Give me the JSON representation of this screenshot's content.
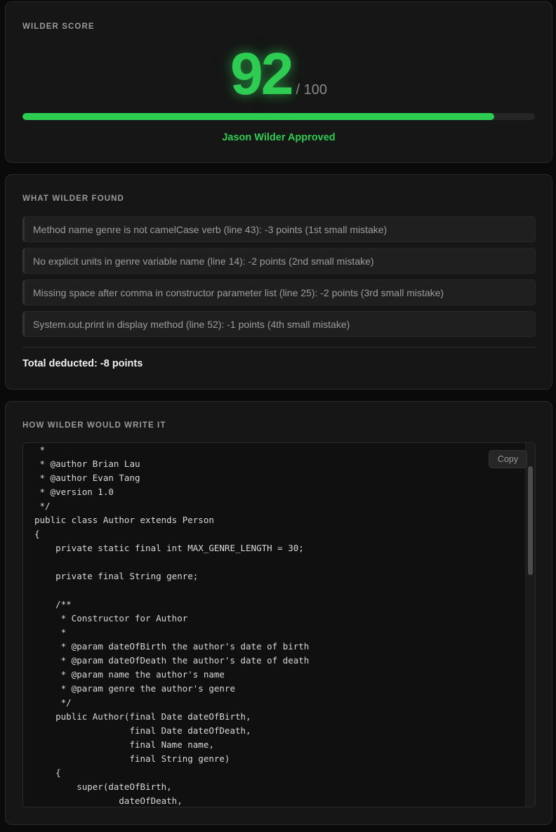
{
  "score_card": {
    "title": "WILDER SCORE",
    "score": "92",
    "max": "/ 100",
    "progress_fraction": 0.92,
    "verdict": "Jason Wilder Approved"
  },
  "findings_card": {
    "title": "WHAT WILDER FOUND",
    "items": [
      "Method name genre is not camelCase verb (line 43): -3 points (1st small mistake)",
      "No explicit units in genre variable name (line 14): -2 points (2nd small mistake)",
      "Missing space after comma in constructor parameter list (line 25): -2 points (3rd small mistake)",
      "System.out.print in display method (line 52): -1 points (4th small mistake)"
    ],
    "total": "Total deducted: -8 points"
  },
  "code_card": {
    "title": "HOW WILDER WOULD WRITE IT",
    "copy_label": "Copy",
    "code": " *\n * @author Brian Lau\n * @author Evan Tang\n * @version 1.0\n */\npublic class Author extends Person\n{\n    private static final int MAX_GENRE_LENGTH = 30;\n\n    private final String genre;\n\n    /**\n     * Constructor for Author\n     *\n     * @param dateOfBirth the author's date of birth\n     * @param dateOfDeath the author's date of death\n     * @param name the author's name\n     * @param genre the author's genre\n     */\n    public Author(final Date dateOfBirth,\n                  final Date dateOfDeath,\n                  final Name name,\n                  final String genre)\n    {\n        super(dateOfBirth,\n                dateOfDeath,"
  },
  "colors": {
    "accent_green": "#2ecc52",
    "background": "#0a0a0a",
    "card": "#161616"
  }
}
